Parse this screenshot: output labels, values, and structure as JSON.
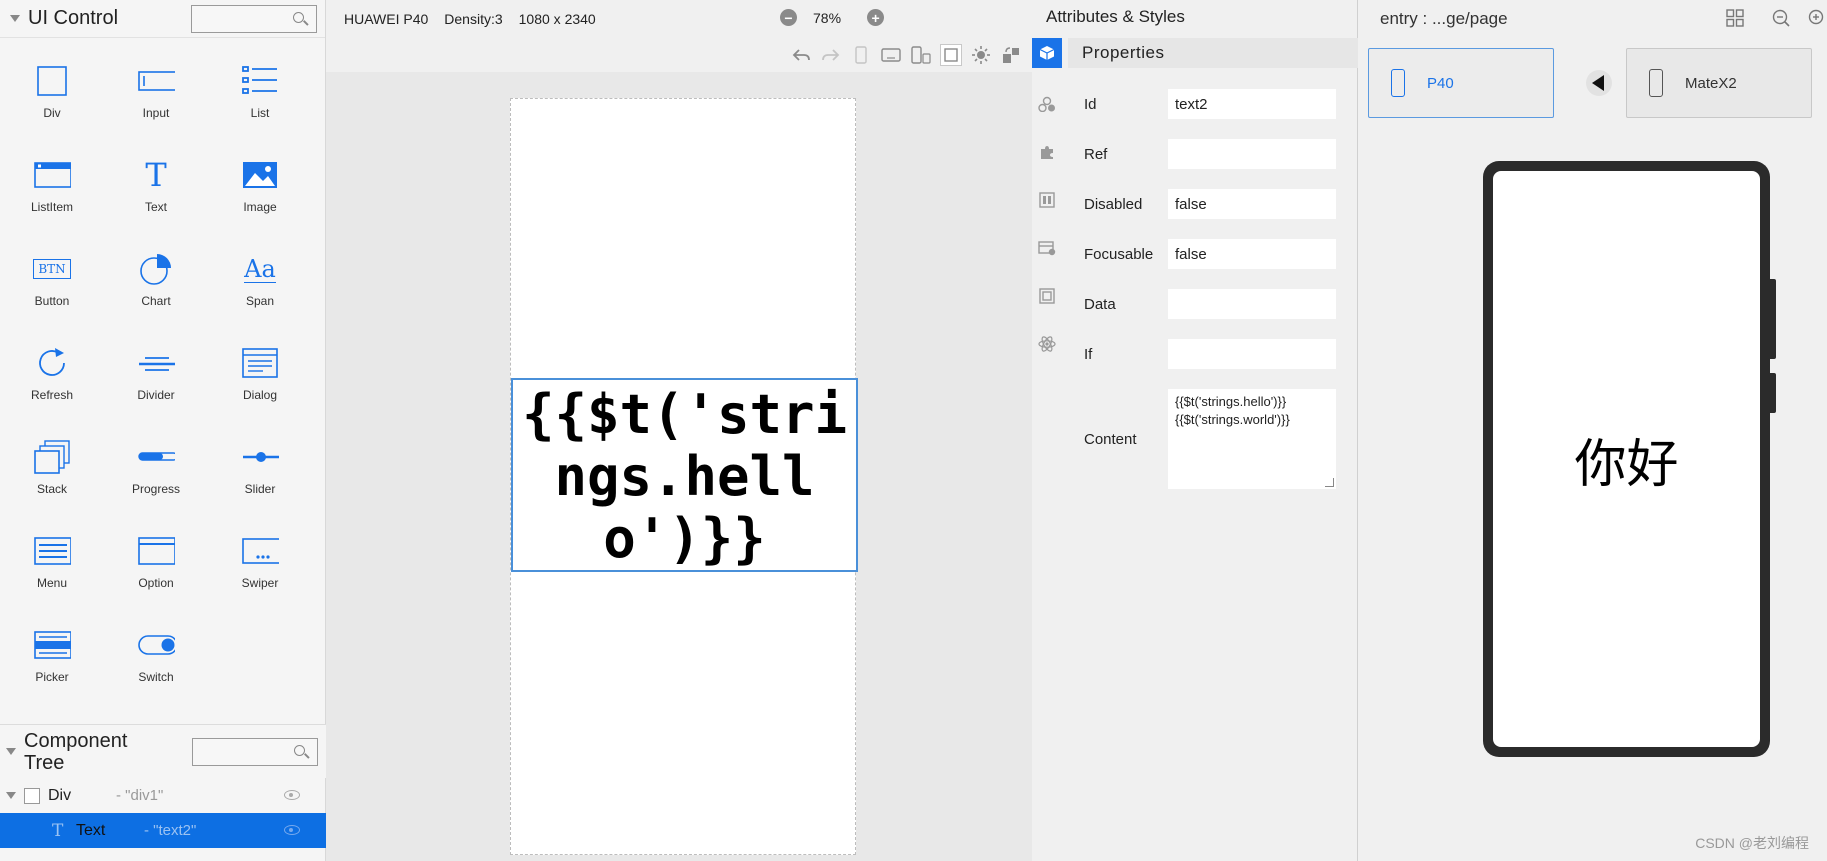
{
  "left_panel": {
    "title": "UI Control",
    "components": [
      {
        "label": "Div",
        "icon": "div-icon"
      },
      {
        "label": "Input",
        "icon": "input-icon"
      },
      {
        "label": "List",
        "icon": "list-icon"
      },
      {
        "label": "ListItem",
        "icon": "listitem-icon"
      },
      {
        "label": "Text",
        "icon": "text-icon"
      },
      {
        "label": "Image",
        "icon": "image-icon"
      },
      {
        "label": "Button",
        "icon": "button-icon"
      },
      {
        "label": "Chart",
        "icon": "chart-icon"
      },
      {
        "label": "Span",
        "icon": "span-icon"
      },
      {
        "label": "Refresh",
        "icon": "refresh-icon"
      },
      {
        "label": "Divider",
        "icon": "divider-icon"
      },
      {
        "label": "Dialog",
        "icon": "dialog-icon"
      },
      {
        "label": "Stack",
        "icon": "stack-icon"
      },
      {
        "label": "Progress",
        "icon": "progress-icon"
      },
      {
        "label": "Slider",
        "icon": "slider-icon"
      },
      {
        "label": "Menu",
        "icon": "menu-icon"
      },
      {
        "label": "Option",
        "icon": "option-icon"
      },
      {
        "label": "Swiper",
        "icon": "swiper-icon"
      },
      {
        "label": "Picker",
        "icon": "picker-icon"
      },
      {
        "label": "Switch",
        "icon": "switch-icon"
      }
    ],
    "btn_glyph": "BTN",
    "text_glyph": "T",
    "span_glyph": "Aa"
  },
  "component_tree": {
    "title_line1": "Component",
    "title_line2": "Tree",
    "rows": [
      {
        "name": "Div",
        "alias": "- \"div1\""
      },
      {
        "name": "Text",
        "alias": "- \"text2\""
      }
    ],
    "text_glyph": "T"
  },
  "canvas": {
    "device_name": "HUAWEI P40",
    "density": "Density:3",
    "resolution": "1080 x 2340",
    "zoom": "78%",
    "zoom_out": "−",
    "zoom_in": "+",
    "text_content": "{{$t('strings.hello')}}"
  },
  "attributes": {
    "title": "Attributes & Styles",
    "section": "Properties",
    "fields": [
      {
        "label": "Id",
        "value": "text2"
      },
      {
        "label": "Ref",
        "value": ""
      },
      {
        "label": "Disabled",
        "value": "false"
      },
      {
        "label": "Focusable",
        "value": "false"
      },
      {
        "label": "Data",
        "value": ""
      },
      {
        "label": "If",
        "value": ""
      }
    ],
    "content_label": "Content",
    "content_line1": "{{$t('strings.hello')}}",
    "content_line2": "{{$t('strings.world')}}"
  },
  "preview": {
    "path": "entry : ...ge/page",
    "devices": [
      {
        "label": "P40",
        "active": true
      },
      {
        "label": "MateX2",
        "active": false
      }
    ],
    "screen_text": "你好"
  },
  "watermark": "CSDN @老刘编程",
  "colors": {
    "accent": "#1a73e8",
    "selection_border": "#4a90d9"
  }
}
